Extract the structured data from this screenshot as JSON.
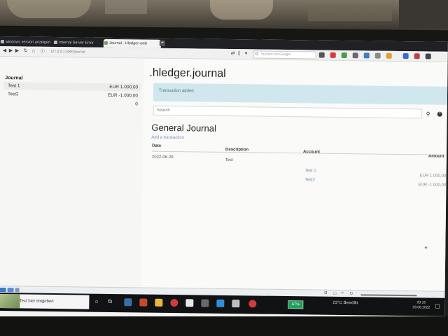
{
  "browser": {
    "tabs": [
      {
        "label": "windows version anzeigen"
      },
      {
        "label": "Internal Server Error"
      },
      {
        "label": "Journal - Hledger-web"
      }
    ],
    "url": "127.0.0.1:5000/journal",
    "search_placeholder": "Suchen mit Google"
  },
  "sidebar": {
    "title": "Journal",
    "accounts": [
      {
        "name": "Test 1",
        "amount": "EUR 1.000,00"
      },
      {
        "name": "Test2",
        "amount": "EUR -1.000,00"
      },
      {
        "name": "",
        "amount": "0"
      }
    ]
  },
  "main": {
    "file_title": ".hledger.journal",
    "flash_message": "Transaction added.",
    "search_placeholder": "Search",
    "journal_title": "General Journal",
    "add_link": "Add a transaction",
    "columns": {
      "date": "Date",
      "description": "Description",
      "account": "Account",
      "amount": "Amount"
    },
    "transaction": {
      "date": "2022-06-29",
      "description": "Test",
      "postings": [
        {
          "account": "Test 1",
          "amount": "EUR 1.000,00"
        },
        {
          "account": "Test2",
          "amount": "EUR -1.000,00"
        }
      ]
    }
  },
  "taskbar": {
    "search_placeholder": "Zur Suche Text hier eingeben",
    "battery": "67%",
    "weather": "23°C  Bewölkt",
    "time": "20:15",
    "date": "29.06.2022"
  }
}
